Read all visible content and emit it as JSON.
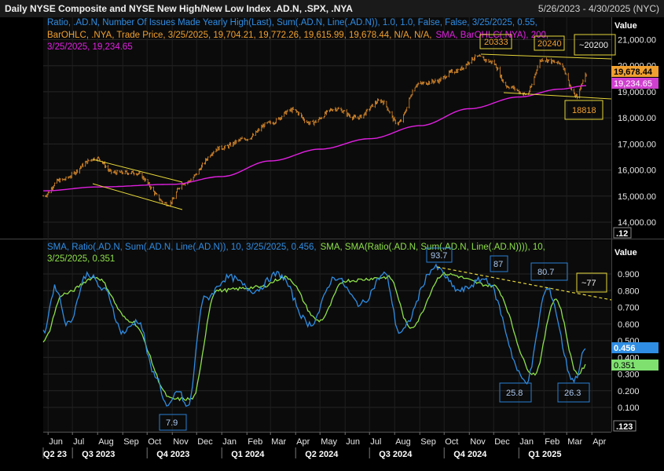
{
  "header": {
    "title": "Daily NYSE Composite and NYSE New High/New Low Index .AD.N, .SPX, .NYA",
    "date_range": "5/26/2023 - 4/30/2025 (NYC)"
  },
  "colors": {
    "price": "#d9892b",
    "sma_top": "#e020e0",
    "ratio_line": "#2f8de4",
    "sma_bottom": "#8ee04a",
    "trendline": "#e6d63a",
    "annotation_border": "#2a7fd4",
    "price_tag": "#f0a030",
    "sma_tag": "#d040d0",
    "ratio_tag": "#2f8de4",
    "sma_bottom_tag": "#7fe070"
  },
  "legend_top": {
    "line1": "Ratio, .AD.N, Number Of Issues Made Yearly High(Last), Sum(.AD.N, Line(.AD.N)),  1.0, 1.0, False, False, 3/25/2025, 0.55,",
    "line2": "BarOHLC, .NYA, Trade Price, 3/25/2025, 19,704.21, 19,772.26, 19,615.99, 19,678.44, N/A, N/A,",
    "line2_sma": "SMA, BarOHLC(.NYA), 200,",
    "line3": "3/25/2025, 19,234.65"
  },
  "legend_bottom": {
    "line1_blue": "SMA, Ratio(.AD.N, Sum(.AD.N, Line(.AD.N)),  10, 3/25/2025, 0.456,",
    "line1_green": "SMA, SMA(Ratio(.AD.N, Sum(.AD.N, Line(.AD.N)))),  10,",
    "line2": "3/25/2025, 0.351"
  },
  "top_axis": {
    "value_label": "Value",
    "ticks": [
      "21,000.00",
      "20,000.00",
      "19,000.00",
      "18,000.00",
      "17,000.00",
      "16,000.00",
      "15,000.00",
      "14,000.00"
    ],
    "tag_price": "19,678.44",
    "tag_sma": "19,234.65",
    "scale_box": ".12"
  },
  "bottom_axis": {
    "value_label": "Value",
    "ticks": [
      "0.900",
      "0.800",
      "0.700",
      "0.600",
      "0.500",
      "0.400",
      "0.300",
      "0.200",
      "0.100"
    ],
    "tag_blue": "0.456",
    "tag_green": "0.351",
    "scale_box": ".123"
  },
  "x_axis": {
    "months": [
      "Jun",
      "Jul",
      "Aug",
      "Sep",
      "Oct",
      "Nov",
      "Dec",
      "Jan",
      "Feb",
      "Mar",
      "Apr",
      "May",
      "Jun",
      "Jul",
      "Aug",
      "Sep",
      "Oct",
      "Nov",
      "Dec",
      "Jan",
      "Feb",
      "Mar",
      "Apr"
    ],
    "quarters": [
      "Q2 23",
      "Q3 2023",
      "Q4 2023",
      "Q1 2024",
      "Q2 2024",
      "Q3 2024",
      "Q4 2024",
      "Q1 2025"
    ]
  },
  "annotations_top": [
    "20333",
    "20240",
    "~20200",
    "18818"
  ],
  "annotations_bottom": [
    "93.7",
    "87",
    "80.7",
    "~77",
    "25.8",
    "26.3",
    "7.9"
  ],
  "chart_data": [
    {
      "type": "line",
      "title": "Daily NYSE Composite (.NYA) OHLC with 200-day SMA",
      "y_range": [
        13500,
        21500
      ],
      "series": [
        {
          "name": "BarOHLC .NYA",
          "points": [
            [
              "2023-05-26",
              15000
            ],
            [
              "2023-06-15",
              15600
            ],
            [
              "2023-07-31",
              16450
            ],
            [
              "2023-08-20",
              15900
            ],
            [
              "2023-09-15",
              15900
            ],
            [
              "2023-10-27",
              14700
            ],
            [
              "2023-11-15",
              15500
            ],
            [
              "2023-12-31",
              16850
            ],
            [
              "2024-01-31",
              17200
            ],
            [
              "2024-02-29",
              17800
            ],
            [
              "2024-03-28",
              18300
            ],
            [
              "2024-04-19",
              17800
            ],
            [
              "2024-05-20",
              18350
            ],
            [
              "2024-06-15",
              18000
            ],
            [
              "2024-07-15",
              18650
            ],
            [
              "2024-08-05",
              17800
            ],
            [
              "2024-08-30",
              19300
            ],
            [
              "2024-09-20",
              19400
            ],
            [
              "2024-10-15",
              19800
            ],
            [
              "2024-11-11",
              20333
            ],
            [
              "2024-11-28",
              20150
            ],
            [
              "2024-12-19",
              19200
            ],
            [
              "2025-01-10",
              18900
            ],
            [
              "2025-01-30",
              20240
            ],
            [
              "2025-02-20",
              20100
            ],
            [
              "2025-03-13",
              18818
            ],
            [
              "2025-03-25",
              19678.44
            ]
          ]
        },
        {
          "name": "SMA 200",
          "points": [
            [
              "2023-05-26",
              15200
            ],
            [
              "2023-08-01",
              15350
            ],
            [
              "2023-11-01",
              15450
            ],
            [
              "2024-01-01",
              15750
            ],
            [
              "2024-03-01",
              16350
            ],
            [
              "2024-05-01",
              16800
            ],
            [
              "2024-07-01",
              17200
            ],
            [
              "2024-09-01",
              17700
            ],
            [
              "2024-11-01",
              18350
            ],
            [
              "2025-01-01",
              18800
            ],
            [
              "2025-02-20",
              19100
            ],
            [
              "2025-03-25",
              19234.65
            ]
          ]
        }
      ]
    },
    {
      "type": "line",
      "title": "NYSE New High/New Low Index",
      "y_range": [
        0.05,
        0.98
      ],
      "series": [
        {
          "name": "SMA 10 Ratio",
          "points": [
            [
              "2023-05-26",
              0.55
            ],
            [
              "2023-06-10",
              0.82
            ],
            [
              "2023-06-25",
              0.6
            ],
            [
              "2023-07-20",
              0.9
            ],
            [
              "2023-08-10",
              0.8
            ],
            [
              "2023-09-01",
              0.55
            ],
            [
              "2023-09-20",
              0.62
            ],
            [
              "2023-10-10",
              0.3
            ],
            [
              "2023-10-27",
              0.1
            ],
            [
              "2023-11-08",
              0.2
            ],
            [
              "2023-11-20",
              0.1
            ],
            [
              "2023-12-10",
              0.75
            ],
            [
              "2024-01-10",
              0.88
            ],
            [
              "2024-02-10",
              0.8
            ],
            [
              "2024-03-10",
              0.9
            ],
            [
              "2024-04-19",
              0.6
            ],
            [
              "2024-05-20",
              0.88
            ],
            [
              "2024-06-20",
              0.72
            ],
            [
              "2024-07-20",
              0.9
            ],
            [
              "2024-08-07",
              0.55
            ],
            [
              "2024-09-20",
              0.937
            ],
            [
              "2024-10-20",
              0.8
            ],
            [
              "2024-11-20",
              0.87
            ],
            [
              "2025-01-10",
              0.258
            ],
            [
              "2025-02-05",
              0.807
            ],
            [
              "2025-03-10",
              0.263
            ],
            [
              "2025-03-25",
              0.456
            ]
          ]
        },
        {
          "name": "SMA 10 of SMA",
          "points": [
            [
              "2023-05-26",
              0.5
            ],
            [
              "2023-06-20",
              0.78
            ],
            [
              "2023-07-30",
              0.88
            ],
            [
              "2023-09-10",
              0.62
            ],
            [
              "2023-11-01",
              0.15
            ],
            [
              "2023-11-25",
              0.15
            ],
            [
              "2023-12-25",
              0.8
            ],
            [
              "2024-02-15",
              0.82
            ],
            [
              "2024-03-20",
              0.88
            ],
            [
              "2024-04-30",
              0.62
            ],
            [
              "2024-06-01",
              0.86
            ],
            [
              "2024-07-25",
              0.88
            ],
            [
              "2024-08-20",
              0.58
            ],
            [
              "2024-10-01",
              0.9
            ],
            [
              "2024-11-30",
              0.83
            ],
            [
              "2025-01-20",
              0.3
            ],
            [
              "2025-02-15",
              0.75
            ],
            [
              "2025-03-15",
              0.3
            ],
            [
              "2025-03-25",
              0.351
            ]
          ]
        }
      ]
    }
  ]
}
